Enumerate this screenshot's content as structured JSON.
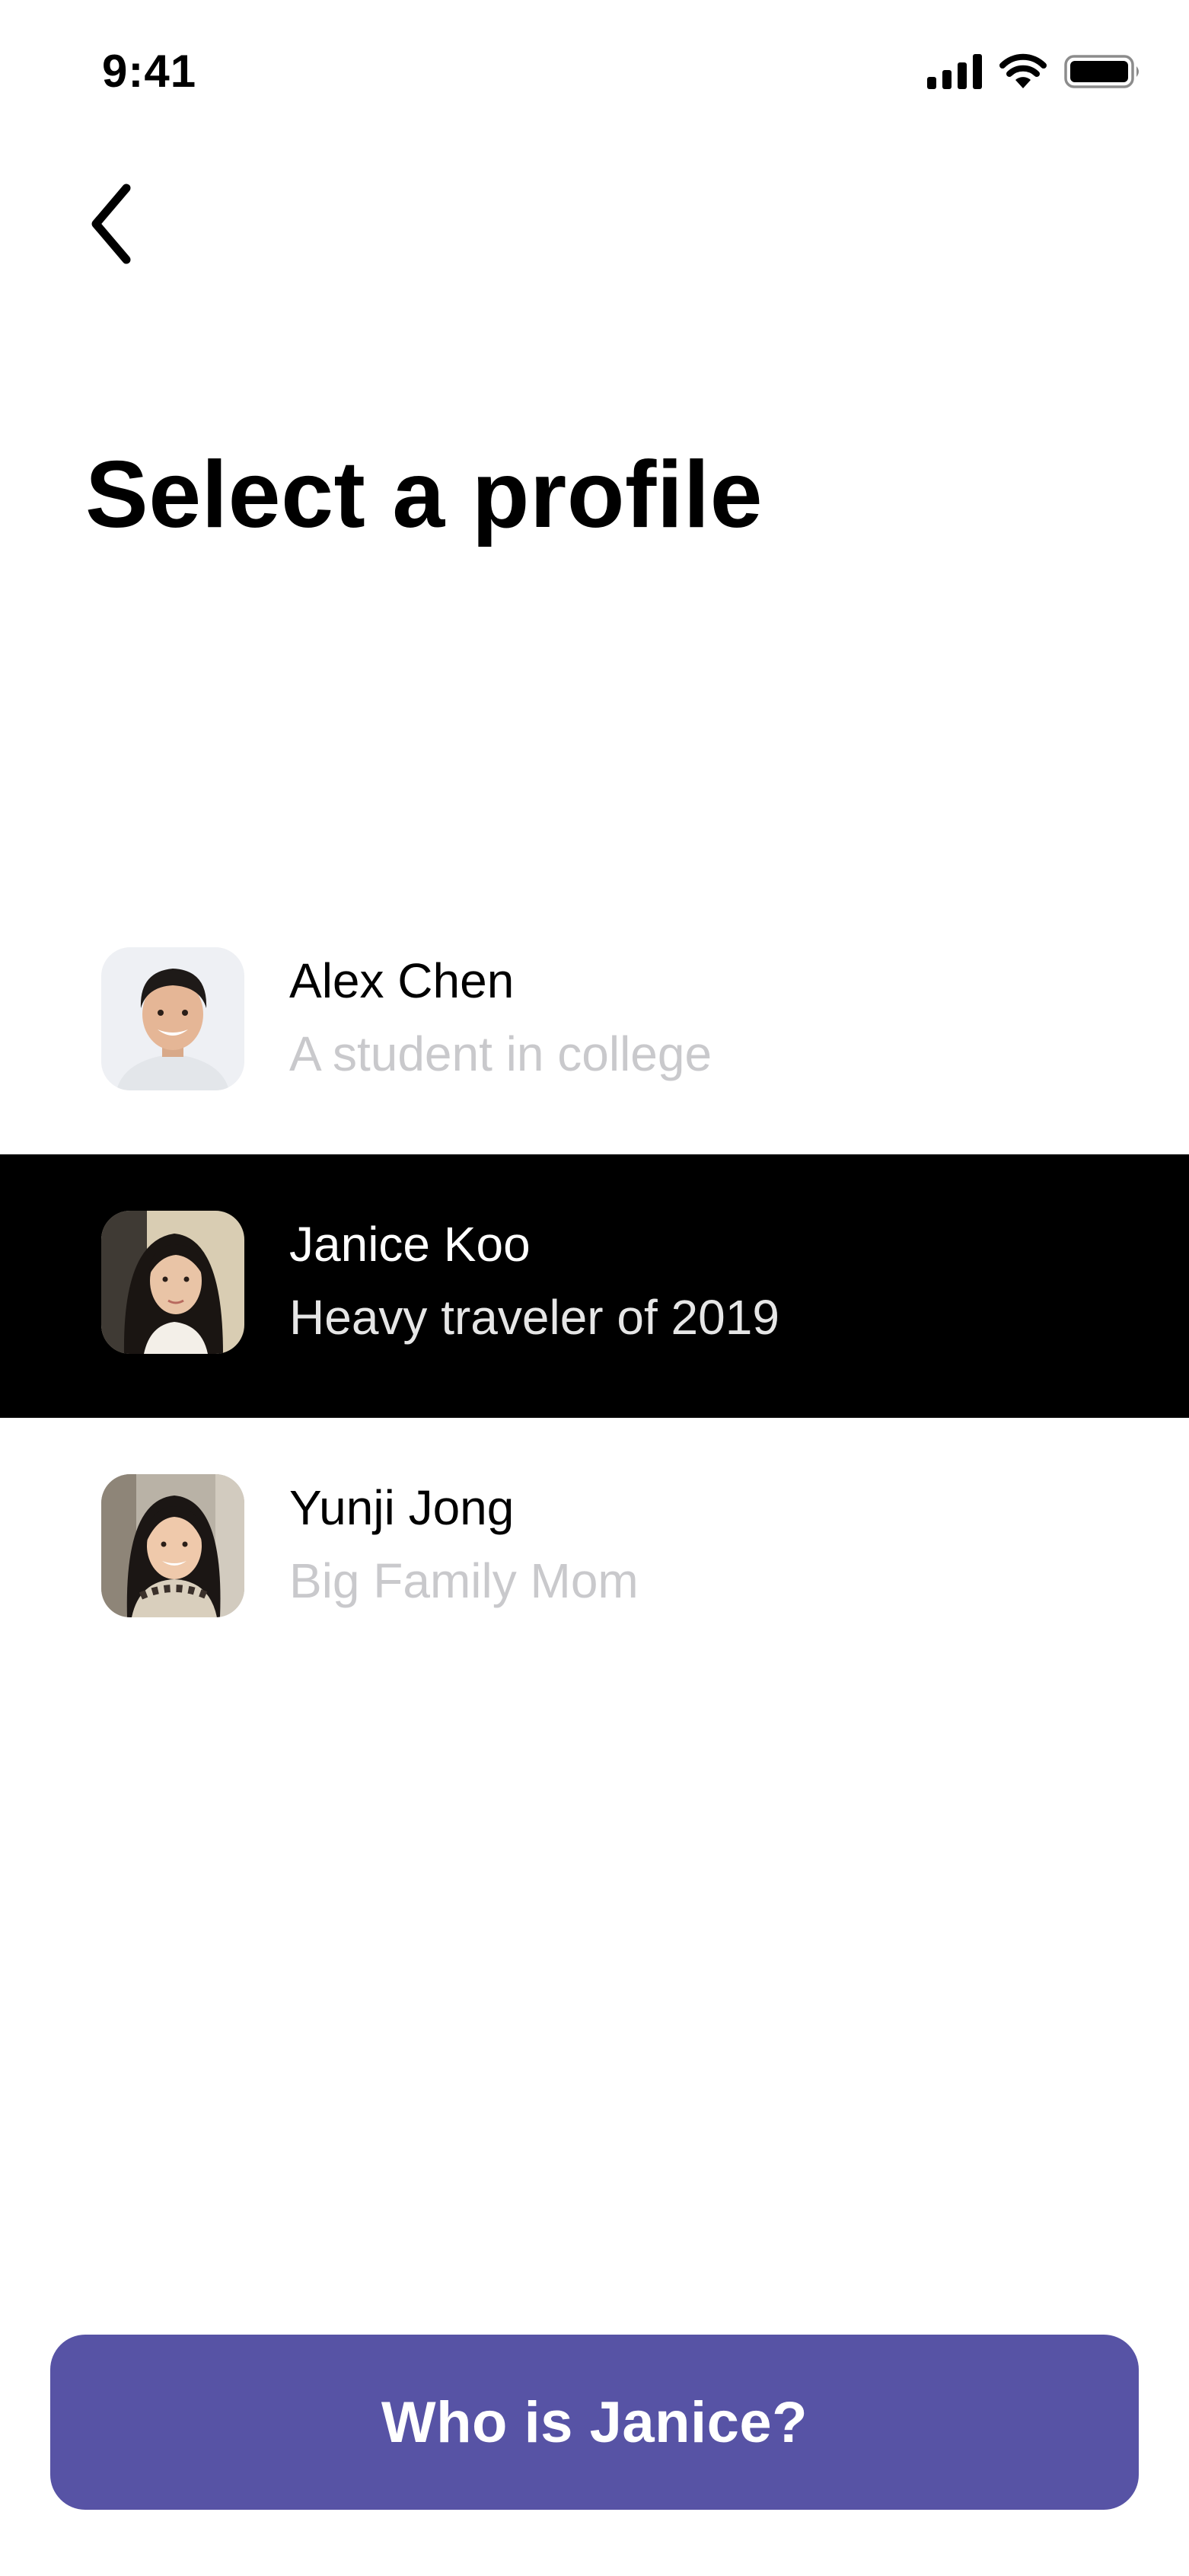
{
  "status_bar": {
    "time": "9:41",
    "icons": [
      "cellular-signal-icon",
      "wifi-icon",
      "battery-icon"
    ]
  },
  "navigation": {
    "back_icon": "chevron-left-icon"
  },
  "title": "Select a profile",
  "profiles": [
    {
      "name": "Alex Chen",
      "description": "A student in college",
      "selected": false
    },
    {
      "name": "Janice Koo",
      "description": "Heavy traveler of 2019",
      "selected": true
    },
    {
      "name": "Yunji Jong",
      "description": "Big Family Mom",
      "selected": false
    }
  ],
  "cta": {
    "label": "Who is Janice?"
  },
  "colors": {
    "accent": "#5753a5",
    "selected_background": "#000000",
    "muted_text": "#c9c9cc"
  }
}
